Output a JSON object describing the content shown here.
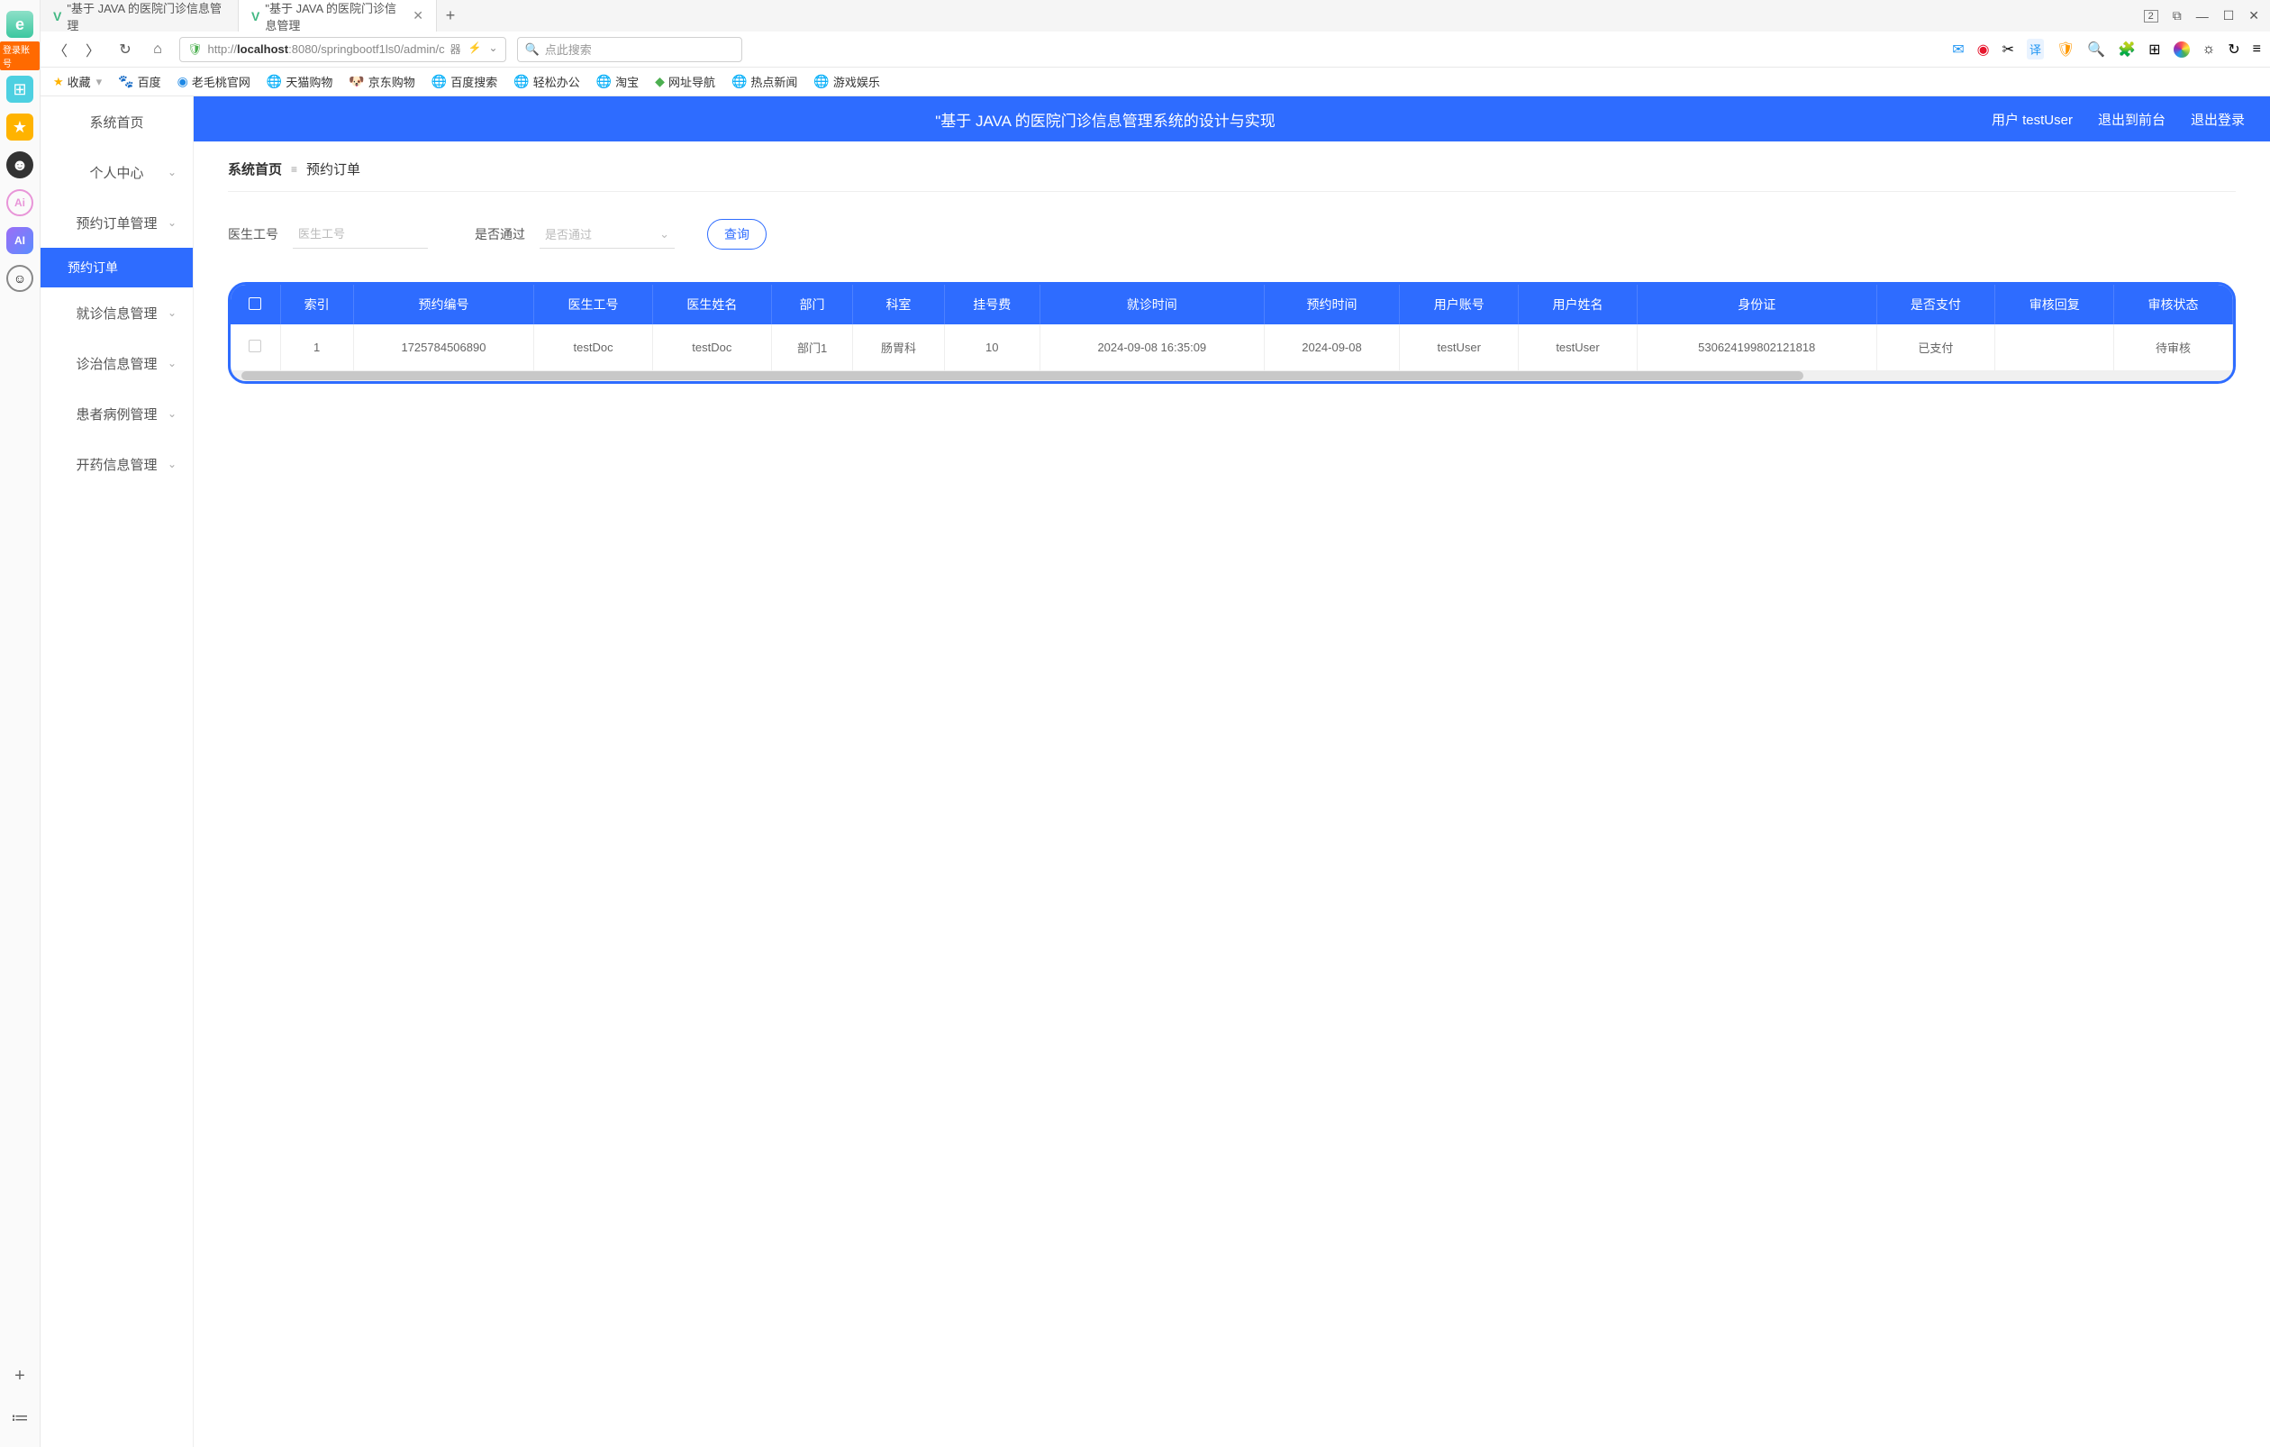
{
  "browser": {
    "login_badge": "登录账号",
    "tabs": [
      {
        "label": "\"基于 JAVA 的医院门诊信息管理",
        "active": false
      },
      {
        "label": "\"基于 JAVA 的医院门诊信息管理",
        "active": true
      }
    ],
    "window_badge": "2",
    "url_prefix": "http://",
    "url_host": "localhost",
    "url_path": ":8080/springbootf1ls0/admin/c",
    "url_badge": "器",
    "search_placeholder": "点此搜索"
  },
  "bookmarks": {
    "fav": "收藏",
    "items": [
      "百度",
      "老毛桃官网",
      "天猫购物",
      "京东购物",
      "百度搜索",
      "轻松办公",
      "淘宝",
      "网址导航",
      "热点新闻",
      "游戏娱乐"
    ]
  },
  "app": {
    "menu": {
      "home": "系统首页",
      "personal": "个人中心",
      "order_mgmt": "预约订单管理",
      "order_sub": "预约订单",
      "visit_mgmt": "就诊信息管理",
      "treat_mgmt": "诊治信息管理",
      "case_mgmt": "患者病例管理",
      "drug_mgmt": "开药信息管理"
    },
    "header": {
      "title": "\"基于 JAVA 的医院门诊信息管理系统的设计与实现",
      "user": "用户 testUser",
      "front": "退出到前台",
      "logout": "退出登录"
    },
    "breadcrumb": {
      "home": "系统首页",
      "current": "预约订单"
    },
    "filters": {
      "doctor_id_label": "医生工号",
      "doctor_id_placeholder": "医生工号",
      "pass_label": "是否通过",
      "pass_placeholder": "是否通过",
      "query_btn": "查询"
    },
    "table": {
      "headers": [
        "",
        "索引",
        "预约编号",
        "医生工号",
        "医生姓名",
        "部门",
        "科室",
        "挂号费",
        "就诊时间",
        "预约时间",
        "用户账号",
        "用户姓名",
        "身份证",
        "是否支付",
        "审核回复",
        "审核状态"
      ],
      "row": {
        "index": "1",
        "order_no": "1725784506890",
        "doc_id": "testDoc",
        "doc_name": "testDoc",
        "dept": "部门1",
        "room": "肠胃科",
        "fee": "10",
        "visit_time": "2024-09-08 16:35:09",
        "reserve_time": "2024-09-08",
        "account": "testUser",
        "username": "testUser",
        "idcard": "530624199802121818",
        "paid": "已支付",
        "reply": "",
        "status": "待审核"
      }
    }
  }
}
